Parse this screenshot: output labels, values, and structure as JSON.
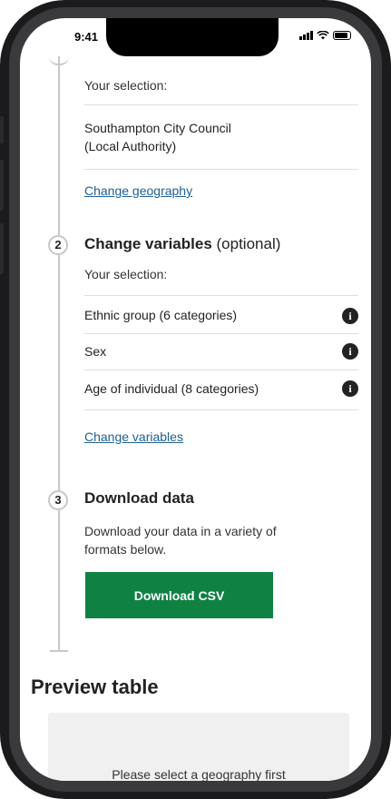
{
  "status_bar": {
    "time": "9:41"
  },
  "geography": {
    "selection_label": "Your selection:",
    "selected_line1": "Southampton City Council",
    "selected_line2": "(Local Authority)",
    "change_link": "Change geography"
  },
  "variables": {
    "step_number": "2",
    "title": "Change variables",
    "optional": "(optional)",
    "selection_label": "Your selection:",
    "items": [
      {
        "label": "Ethnic group (6 categories)",
        "info_icon": "info-icon"
      },
      {
        "label": "Sex",
        "info_icon": "info-icon"
      },
      {
        "label": "Age of individual (8 categories)",
        "info_icon": "info-icon"
      }
    ],
    "change_link": "Change variables"
  },
  "download": {
    "step_number": "3",
    "title": "Download data",
    "description_line1": "Download your data in a variety of",
    "description_line2": "formats below.",
    "button_label": "Download CSV",
    "button_color": "#0f8243"
  },
  "preview": {
    "title": "Preview table",
    "message": "Please select a geography first"
  },
  "colors": {
    "link": "#206095",
    "text": "#222222"
  }
}
